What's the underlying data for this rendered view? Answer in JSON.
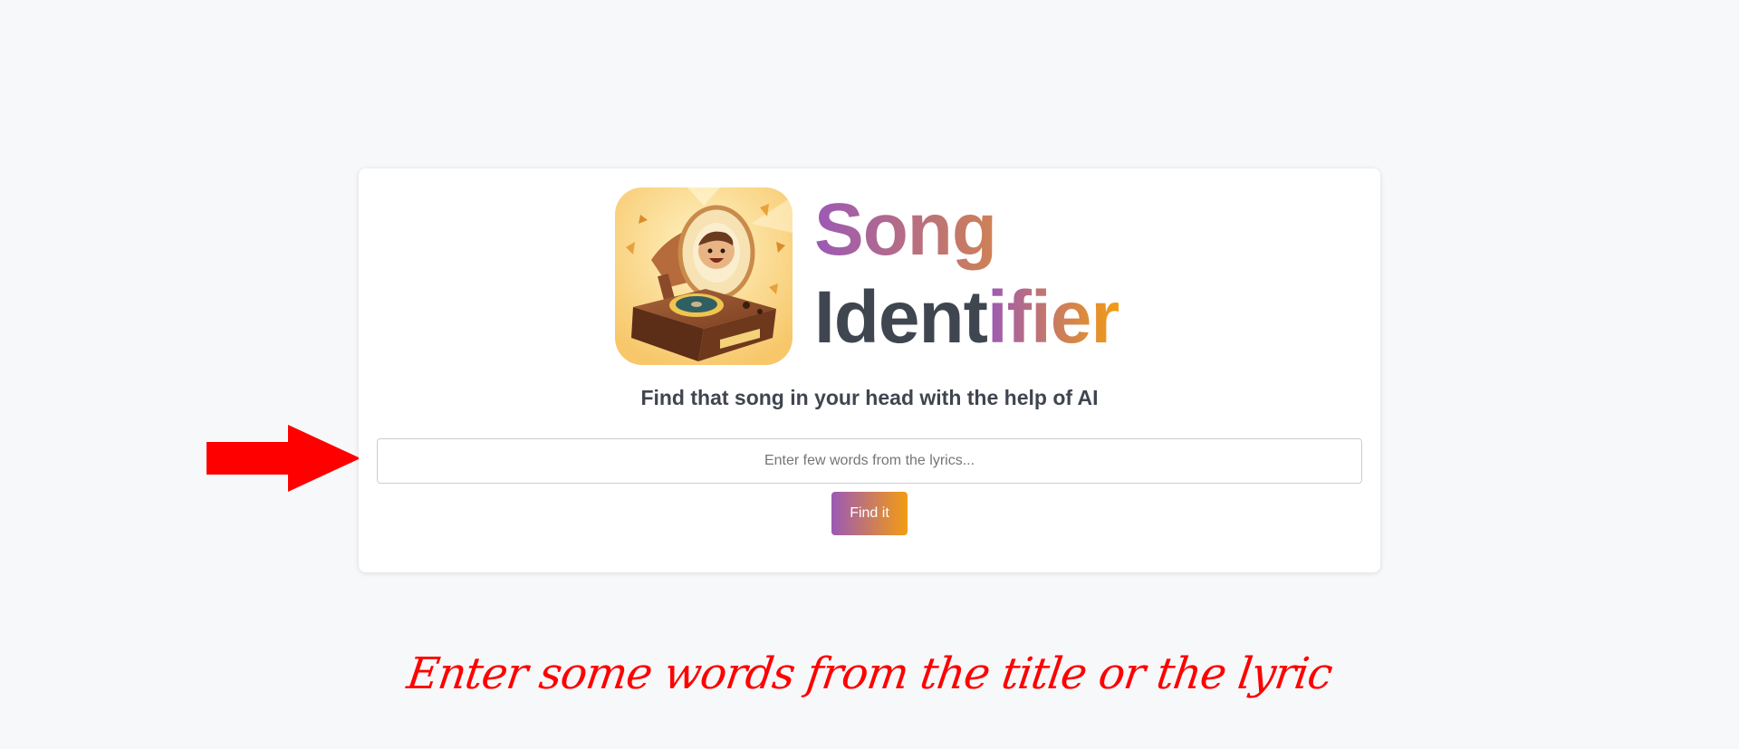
{
  "brand": {
    "word1": "Song",
    "word2_dark": "Ident",
    "word2_grad": "ifier",
    "gradient_start": "#9b59b6",
    "gradient_end": "#f39c12",
    "dark_color": "#3f4650",
    "logo_icon": "gramophone-mascot-icon"
  },
  "tagline": "Find that song in your head with the help of AI",
  "search": {
    "placeholder": "Enter few words from the lyrics...",
    "value": ""
  },
  "find_button": {
    "label": "Find it"
  },
  "annotation": {
    "arrow_icon": "right-arrow-icon",
    "arrow_color": "#ff0000",
    "hint": "Enter some words from the title or the lyric"
  }
}
